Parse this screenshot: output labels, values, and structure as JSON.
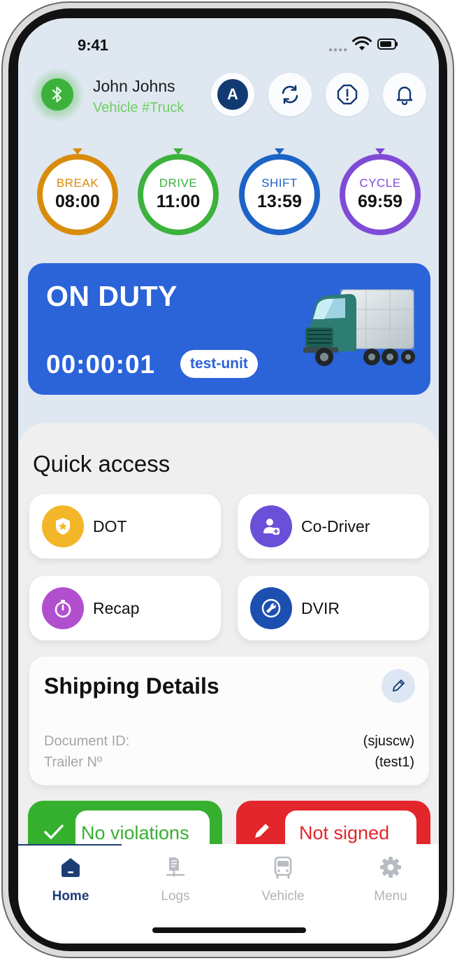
{
  "status_bar": {
    "time": "9:41"
  },
  "header": {
    "user_name": "John Johns",
    "vehicle": "Vehicle #Truck",
    "avatar_initial": "A",
    "colors": {
      "bluetooth": "#3cb23c",
      "vehicle_text": "#6fcf62",
      "avatar": "#123a72"
    },
    "icons": [
      "bluetooth-icon",
      "refresh-icon",
      "alert-octagon-icon",
      "bell-icon"
    ]
  },
  "timers": [
    {
      "label": "BREAK",
      "value": "08:00",
      "color": "#d98c0c"
    },
    {
      "label": "DRIVE",
      "value": "11:00",
      "color": "#3cb23c"
    },
    {
      "label": "SHIFT",
      "value": "13:59",
      "color": "#1c63c6"
    },
    {
      "label": "CYCLE",
      "value": "69:59",
      "color": "#7f4bd6"
    }
  ],
  "duty": {
    "status": "ON DUTY",
    "elapsed": "00:00:01",
    "unit": "test-unit",
    "color": "#2b63d8"
  },
  "quick_access": {
    "title": "Quick access",
    "items": [
      {
        "label": "DOT",
        "icon": "shield-star-icon",
        "color": "#f3b629"
      },
      {
        "label": "Co-Driver",
        "icon": "user-add-icon",
        "color": "#6b4fd8"
      },
      {
        "label": "Recap",
        "icon": "stopwatch-icon",
        "color": "#b24fcf"
      },
      {
        "label": "DVIR",
        "icon": "wrench-icon",
        "color": "#1d4fb0"
      }
    ]
  },
  "shipping": {
    "title": "Shipping Details",
    "rows": [
      {
        "key": "Document ID:",
        "value": "(sjuscw)"
      },
      {
        "key": "Trailer Nº",
        "value": "(test1)"
      }
    ]
  },
  "status_cards": {
    "violations": {
      "label": "No violations",
      "color": "#36b12f"
    },
    "signature": {
      "label": "Not signed",
      "color": "#e3262b"
    }
  },
  "tabs": [
    {
      "label": "Home",
      "icon": "home-icon",
      "active": true
    },
    {
      "label": "Logs",
      "icon": "logs-icon",
      "active": false
    },
    {
      "label": "Vehicle",
      "icon": "bus-icon",
      "active": false
    },
    {
      "label": "Menu",
      "icon": "gear-icon",
      "active": false
    }
  ]
}
